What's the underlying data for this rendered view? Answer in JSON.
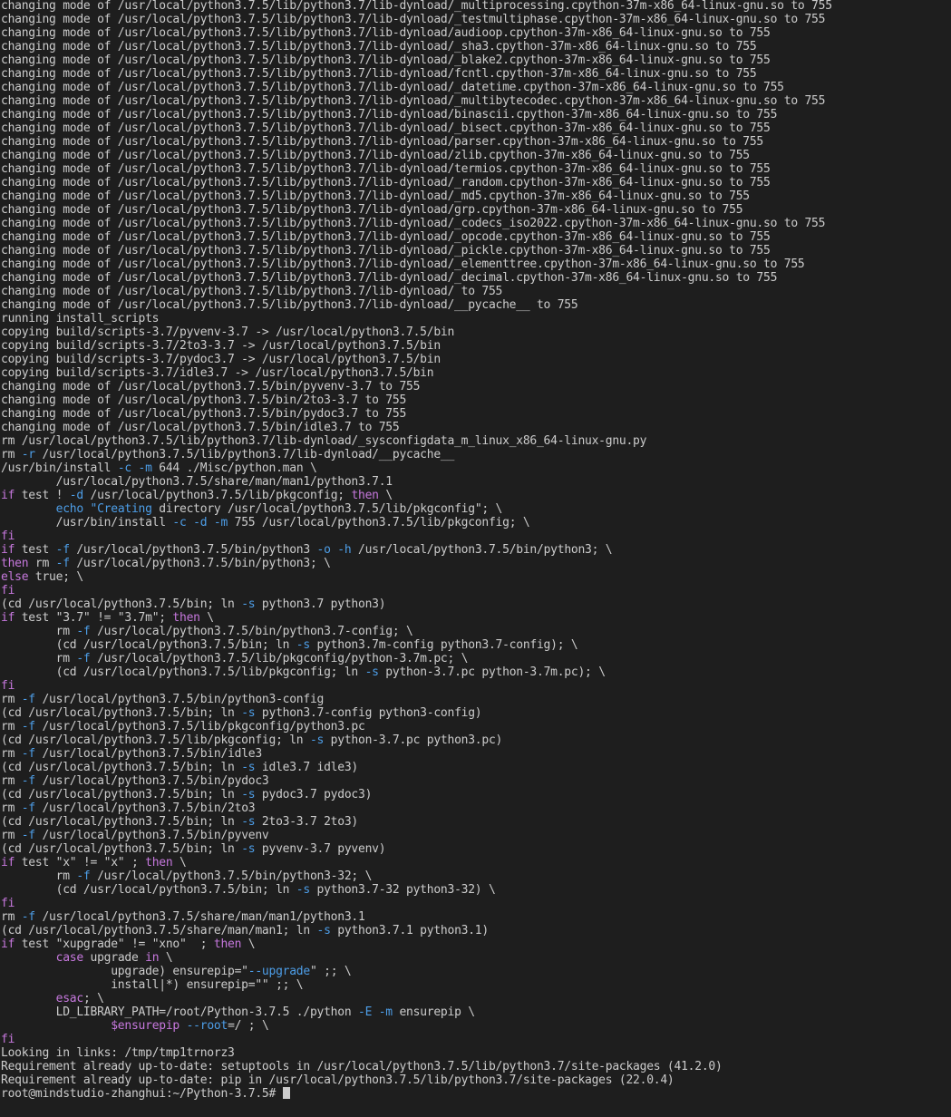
{
  "colors": {
    "background": "#1e1e1e",
    "text": "#cccccc",
    "keyword": "#c678dd",
    "option": "#4d9ee8"
  },
  "terminal": {
    "lines": [
      [
        [
          "changing mode of /usr/local/python3.7.5/lib/python3.7/lib-dynload/_multiprocessing.cpython-37m-x86_64-linux-gnu.so to 755",
          "t"
        ]
      ],
      [
        [
          "changing mode of /usr/local/python3.7.5/lib/python3.7/lib-dynload/_testmultiphase.cpython-37m-x86_64-linux-gnu.so to 755",
          "t"
        ]
      ],
      [
        [
          "changing mode of /usr/local/python3.7.5/lib/python3.7/lib-dynload/audioop.cpython-37m-x86_64-linux-gnu.so to 755",
          "t"
        ]
      ],
      [
        [
          "changing mode of /usr/local/python3.7.5/lib/python3.7/lib-dynload/_sha3.cpython-37m-x86_64-linux-gnu.so to 755",
          "t"
        ]
      ],
      [
        [
          "changing mode of /usr/local/python3.7.5/lib/python3.7/lib-dynload/_blake2.cpython-37m-x86_64-linux-gnu.so to 755",
          "t"
        ]
      ],
      [
        [
          "changing mode of /usr/local/python3.7.5/lib/python3.7/lib-dynload/fcntl.cpython-37m-x86_64-linux-gnu.so to 755",
          "t"
        ]
      ],
      [
        [
          "changing mode of /usr/local/python3.7.5/lib/python3.7/lib-dynload/_datetime.cpython-37m-x86_64-linux-gnu.so to 755",
          "t"
        ]
      ],
      [
        [
          "changing mode of /usr/local/python3.7.5/lib/python3.7/lib-dynload/_multibytecodec.cpython-37m-x86_64-linux-gnu.so to 755",
          "t"
        ]
      ],
      [
        [
          "changing mode of /usr/local/python3.7.5/lib/python3.7/lib-dynload/binascii.cpython-37m-x86_64-linux-gnu.so to 755",
          "t"
        ]
      ],
      [
        [
          "changing mode of /usr/local/python3.7.5/lib/python3.7/lib-dynload/_bisect.cpython-37m-x86_64-linux-gnu.so to 755",
          "t"
        ]
      ],
      [
        [
          "changing mode of /usr/local/python3.7.5/lib/python3.7/lib-dynload/parser.cpython-37m-x86_64-linux-gnu.so to 755",
          "t"
        ]
      ],
      [
        [
          "changing mode of /usr/local/python3.7.5/lib/python3.7/lib-dynload/zlib.cpython-37m-x86_64-linux-gnu.so to 755",
          "t"
        ]
      ],
      [
        [
          "changing mode of /usr/local/python3.7.5/lib/python3.7/lib-dynload/termios.cpython-37m-x86_64-linux-gnu.so to 755",
          "t"
        ]
      ],
      [
        [
          "changing mode of /usr/local/python3.7.5/lib/python3.7/lib-dynload/_random.cpython-37m-x86_64-linux-gnu.so to 755",
          "t"
        ]
      ],
      [
        [
          "changing mode of /usr/local/python3.7.5/lib/python3.7/lib-dynload/_md5.cpython-37m-x86_64-linux-gnu.so to 755",
          "t"
        ]
      ],
      [
        [
          "changing mode of /usr/local/python3.7.5/lib/python3.7/lib-dynload/grp.cpython-37m-x86_64-linux-gnu.so to 755",
          "t"
        ]
      ],
      [
        [
          "changing mode of /usr/local/python3.7.5/lib/python3.7/lib-dynload/_codecs_iso2022.cpython-37m-x86_64-linux-gnu.so to 755",
          "t"
        ]
      ],
      [
        [
          "changing mode of /usr/local/python3.7.5/lib/python3.7/lib-dynload/_opcode.cpython-37m-x86_64-linux-gnu.so to 755",
          "t"
        ]
      ],
      [
        [
          "changing mode of /usr/local/python3.7.5/lib/python3.7/lib-dynload/_pickle.cpython-37m-x86_64-linux-gnu.so to 755",
          "t"
        ]
      ],
      [
        [
          "changing mode of /usr/local/python3.7.5/lib/python3.7/lib-dynload/_elementtree.cpython-37m-x86_64-linux-gnu.so to 755",
          "t"
        ]
      ],
      [
        [
          "changing mode of /usr/local/python3.7.5/lib/python3.7/lib-dynload/_decimal.cpython-37m-x86_64-linux-gnu.so to 755",
          "t"
        ]
      ],
      [
        [
          "changing mode of /usr/local/python3.7.5/lib/python3.7/lib-dynload/ to 755",
          "t"
        ]
      ],
      [
        [
          "changing mode of /usr/local/python3.7.5/lib/python3.7/lib-dynload/__pycache__ to 755",
          "t"
        ]
      ],
      [
        [
          "running install_scripts",
          "t"
        ]
      ],
      [
        [
          "copying build/scripts-3.7/pyvenv-3.7 -> /usr/local/python3.7.5/bin",
          "t"
        ]
      ],
      [
        [
          "copying build/scripts-3.7/2to3-3.7 -> /usr/local/python3.7.5/bin",
          "t"
        ]
      ],
      [
        [
          "copying build/scripts-3.7/pydoc3.7 -> /usr/local/python3.7.5/bin",
          "t"
        ]
      ],
      [
        [
          "copying build/scripts-3.7/idle3.7 -> /usr/local/python3.7.5/bin",
          "t"
        ]
      ],
      [
        [
          "changing mode of /usr/local/python3.7.5/bin/pyvenv-3.7 to 755",
          "t"
        ]
      ],
      [
        [
          "changing mode of /usr/local/python3.7.5/bin/2to3-3.7 to 755",
          "t"
        ]
      ],
      [
        [
          "changing mode of /usr/local/python3.7.5/bin/pydoc3.7 to 755",
          "t"
        ]
      ],
      [
        [
          "changing mode of /usr/local/python3.7.5/bin/idle3.7 to 755",
          "t"
        ]
      ],
      [
        [
          "rm /usr/local/python3.7.5/lib/python3.7/lib-dynload/_sysconfigdata_m_linux_x86_64-linux-gnu.py",
          "t"
        ]
      ],
      [
        [
          "rm ",
          "t"
        ],
        [
          "-r",
          "o"
        ],
        [
          " /usr/local/python3.7.5/lib/python3.7/lib-dynload/__pycache__",
          "t"
        ]
      ],
      [
        [
          "/usr/bin/install ",
          "t"
        ],
        [
          "-c",
          "o"
        ],
        [
          " ",
          "t"
        ],
        [
          "-m",
          "o"
        ],
        [
          " 644 ./Misc/python.man \\",
          "t"
        ]
      ],
      [
        [
          "        /usr/local/python3.7.5/share/man/man1/python3.7.1",
          "t"
        ]
      ],
      [
        [
          "if",
          "k"
        ],
        [
          " test ! ",
          "t"
        ],
        [
          "-d",
          "o"
        ],
        [
          " /usr/local/python3.7.5/lib/pkgconfig; ",
          "t"
        ],
        [
          "then",
          "k"
        ],
        [
          " \\",
          "t"
        ]
      ],
      [
        [
          "        ",
          "t"
        ],
        [
          "echo",
          "o"
        ],
        [
          " ",
          "t"
        ],
        [
          "\"Creating",
          "o"
        ],
        [
          " directory /usr/local/python3.7.5/lib/pkgconfig\"; \\",
          "t"
        ]
      ],
      [
        [
          "        /usr/bin/install ",
          "t"
        ],
        [
          "-c",
          "o"
        ],
        [
          " ",
          "t"
        ],
        [
          "-d",
          "o"
        ],
        [
          " ",
          "t"
        ],
        [
          "-m",
          "o"
        ],
        [
          " 755 /usr/local/python3.7.5/lib/pkgconfig; \\",
          "t"
        ]
      ],
      [
        [
          "fi",
          "k"
        ]
      ],
      [
        [
          "if",
          "k"
        ],
        [
          " test ",
          "t"
        ],
        [
          "-f",
          "o"
        ],
        [
          " /usr/local/python3.7.5/bin/python3 ",
          "t"
        ],
        [
          "-o",
          "o"
        ],
        [
          " ",
          "t"
        ],
        [
          "-h",
          "o"
        ],
        [
          " /usr/local/python3.7.5/bin/python3; \\",
          "t"
        ]
      ],
      [
        [
          "then",
          "k"
        ],
        [
          " rm ",
          "t"
        ],
        [
          "-f",
          "o"
        ],
        [
          " /usr/local/python3.7.5/bin/python3; \\",
          "t"
        ]
      ],
      [
        [
          "else",
          "k"
        ],
        [
          " true; \\",
          "t"
        ]
      ],
      [
        [
          "fi",
          "k"
        ]
      ],
      [
        [
          "(cd /usr/local/python3.7.5/bin; ln ",
          "t"
        ],
        [
          "-s",
          "o"
        ],
        [
          " python3.7 python3)",
          "t"
        ]
      ],
      [
        [
          "if",
          "k"
        ],
        [
          " test \"3.7\" != \"3.7m\"; ",
          "t"
        ],
        [
          "then",
          "k"
        ],
        [
          " \\",
          "t"
        ]
      ],
      [
        [
          "        rm ",
          "t"
        ],
        [
          "-f",
          "o"
        ],
        [
          " /usr/local/python3.7.5/bin/python3.7-config; \\",
          "t"
        ]
      ],
      [
        [
          "        (cd /usr/local/python3.7.5/bin; ln ",
          "t"
        ],
        [
          "-s",
          "o"
        ],
        [
          " python3.7m-config python3.7-config); \\",
          "t"
        ]
      ],
      [
        [
          "        rm ",
          "t"
        ],
        [
          "-f",
          "o"
        ],
        [
          " /usr/local/python3.7.5/lib/pkgconfig/python-3.7m.pc; \\",
          "t"
        ]
      ],
      [
        [
          "        (cd /usr/local/python3.7.5/lib/pkgconfig; ln ",
          "t"
        ],
        [
          "-s",
          "o"
        ],
        [
          " python-3.7.pc python-3.7m.pc); \\",
          "t"
        ]
      ],
      [
        [
          "fi",
          "k"
        ]
      ],
      [
        [
          "rm ",
          "t"
        ],
        [
          "-f",
          "o"
        ],
        [
          " /usr/local/python3.7.5/bin/python3-config",
          "t"
        ]
      ],
      [
        [
          "(cd /usr/local/python3.7.5/bin; ln ",
          "t"
        ],
        [
          "-s",
          "o"
        ],
        [
          " python3.7-config python3-config)",
          "t"
        ]
      ],
      [
        [
          "rm ",
          "t"
        ],
        [
          "-f",
          "o"
        ],
        [
          " /usr/local/python3.7.5/lib/pkgconfig/python3.pc",
          "t"
        ]
      ],
      [
        [
          "(cd /usr/local/python3.7.5/lib/pkgconfig; ln ",
          "t"
        ],
        [
          "-s",
          "o"
        ],
        [
          " python-3.7.pc python3.pc)",
          "t"
        ]
      ],
      [
        [
          "rm ",
          "t"
        ],
        [
          "-f",
          "o"
        ],
        [
          " /usr/local/python3.7.5/bin/idle3",
          "t"
        ]
      ],
      [
        [
          "(cd /usr/local/python3.7.5/bin; ln ",
          "t"
        ],
        [
          "-s",
          "o"
        ],
        [
          " idle3.7 idle3)",
          "t"
        ]
      ],
      [
        [
          "rm ",
          "t"
        ],
        [
          "-f",
          "o"
        ],
        [
          " /usr/local/python3.7.5/bin/pydoc3",
          "t"
        ]
      ],
      [
        [
          "(cd /usr/local/python3.7.5/bin; ln ",
          "t"
        ],
        [
          "-s",
          "o"
        ],
        [
          " pydoc3.7 pydoc3)",
          "t"
        ]
      ],
      [
        [
          "rm ",
          "t"
        ],
        [
          "-f",
          "o"
        ],
        [
          " /usr/local/python3.7.5/bin/2to3",
          "t"
        ]
      ],
      [
        [
          "(cd /usr/local/python3.7.5/bin; ln ",
          "t"
        ],
        [
          "-s",
          "o"
        ],
        [
          " 2to3-3.7 2to3)",
          "t"
        ]
      ],
      [
        [
          "rm ",
          "t"
        ],
        [
          "-f",
          "o"
        ],
        [
          " /usr/local/python3.7.5/bin/pyvenv",
          "t"
        ]
      ],
      [
        [
          "(cd /usr/local/python3.7.5/bin; ln ",
          "t"
        ],
        [
          "-s",
          "o"
        ],
        [
          " pyvenv-3.7 pyvenv)",
          "t"
        ]
      ],
      [
        [
          "if",
          "k"
        ],
        [
          " test \"x\" != \"x\" ; ",
          "t"
        ],
        [
          "then",
          "k"
        ],
        [
          " \\",
          "t"
        ]
      ],
      [
        [
          "        rm ",
          "t"
        ],
        [
          "-f",
          "o"
        ],
        [
          " /usr/local/python3.7.5/bin/python3-32; \\",
          "t"
        ]
      ],
      [
        [
          "        (cd /usr/local/python3.7.5/bin; ln ",
          "t"
        ],
        [
          "-s",
          "o"
        ],
        [
          " python3.7-32 python3-32) \\",
          "t"
        ]
      ],
      [
        [
          "fi",
          "k"
        ]
      ],
      [
        [
          "rm ",
          "t"
        ],
        [
          "-f",
          "o"
        ],
        [
          " /usr/local/python3.7.5/share/man/man1/python3.1",
          "t"
        ]
      ],
      [
        [
          "(cd /usr/local/python3.7.5/share/man/man1; ln ",
          "t"
        ],
        [
          "-s",
          "o"
        ],
        [
          " python3.7.1 python3.1)",
          "t"
        ]
      ],
      [
        [
          "if",
          "k"
        ],
        [
          " test \"xupgrade\" != \"xno\"  ; ",
          "t"
        ],
        [
          "then",
          "k"
        ],
        [
          " \\",
          "t"
        ]
      ],
      [
        [
          "        ",
          "t"
        ],
        [
          "case",
          "k"
        ],
        [
          " upgrade ",
          "t"
        ],
        [
          "in",
          "k"
        ],
        [
          " \\",
          "t"
        ]
      ],
      [
        [
          "                upgrade) ensurepip=\"",
          "t"
        ],
        [
          "--upgrade",
          "o"
        ],
        [
          "\" ;; \\",
          "t"
        ]
      ],
      [
        [
          "                install|*) ensurepip=\"\" ;; \\",
          "t"
        ]
      ],
      [
        [
          "        ",
          "t"
        ],
        [
          "esac",
          "k"
        ],
        [
          "; \\",
          "t"
        ]
      ],
      [
        [
          "        LD_LIBRARY_PATH=/root/Python-3.7.5 ./python ",
          "t"
        ],
        [
          "-E",
          "o"
        ],
        [
          " ",
          "t"
        ],
        [
          "-m",
          "o"
        ],
        [
          " ensurepip \\",
          "t"
        ]
      ],
      [
        [
          "                ",
          "t"
        ],
        [
          "$ensurepip",
          "v"
        ],
        [
          " ",
          "t"
        ],
        [
          "--root",
          "o"
        ],
        [
          "=/ ; \\",
          "t"
        ]
      ],
      [
        [
          "fi",
          "k"
        ]
      ],
      [
        [
          "Looking in links: /tmp/tmp1trnorz3",
          "t"
        ]
      ],
      [
        [
          "Requirement already up-to-date: setuptools in /usr/local/python3.7.5/lib/python3.7/site-packages (41.2.0)",
          "t"
        ]
      ],
      [
        [
          "Requirement already up-to-date: pip in /usr/local/python3.7.5/lib/python3.7/site-packages (22.0.4)",
          "t"
        ]
      ]
    ],
    "prompt": "root@mindstudio-zhanghui:~/Python-3.7.5# "
  }
}
